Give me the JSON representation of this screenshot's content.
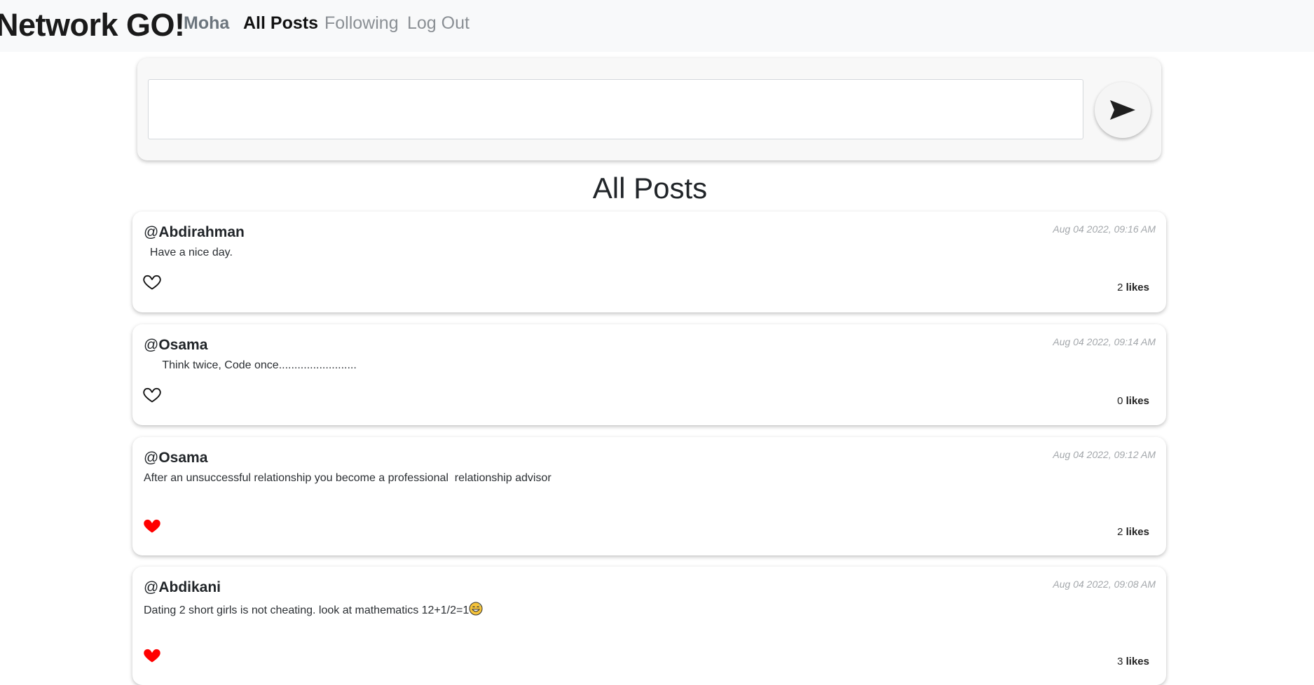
{
  "nav": {
    "brand": "Network GO!",
    "user": "Moha",
    "all_posts": "All Posts",
    "following": "Following",
    "logout": "Log Out"
  },
  "compose": {
    "placeholder": "",
    "send_icon": "send-arrow-icon"
  },
  "page_title": "All Posts",
  "like_icon_outline": "heart-outline-icon",
  "like_icon_filled": "heart-filled-icon",
  "colors": {
    "liked": "#ff0000",
    "navbar_bg": "#f8f9fa"
  },
  "posts": [
    {
      "at": "@",
      "author": "Abdirahman",
      "date": "Aug 04 2022, 09:16 AM",
      "body": "  Have a nice day.",
      "liked": false,
      "likes": "2",
      "likes_label": "likes"
    },
    {
      "at": "@",
      "author": "Osama",
      "date": "Aug 04 2022, 09:14 AM",
      "body": "      Think twice, Code once.........................",
      "liked": false,
      "likes": "0",
      "likes_label": "likes"
    },
    {
      "at": "@",
      "author": "Osama",
      "date": "Aug 04 2022, 09:12 AM",
      "body": "After an unsuccessful relationship you become a professional  relationship advisor",
      "liked": true,
      "likes": "2",
      "likes_label": "likes"
    },
    {
      "at": "@",
      "author": "Abdikani",
      "date": "Aug 04 2022, 09:08 AM",
      "body": "Dating 2 short girls is not cheating. look at mathematics 12+1/2=1",
      "emoji": "grinning-sweat-emoji",
      "liked": true,
      "likes": "3",
      "likes_label": "likes"
    }
  ]
}
